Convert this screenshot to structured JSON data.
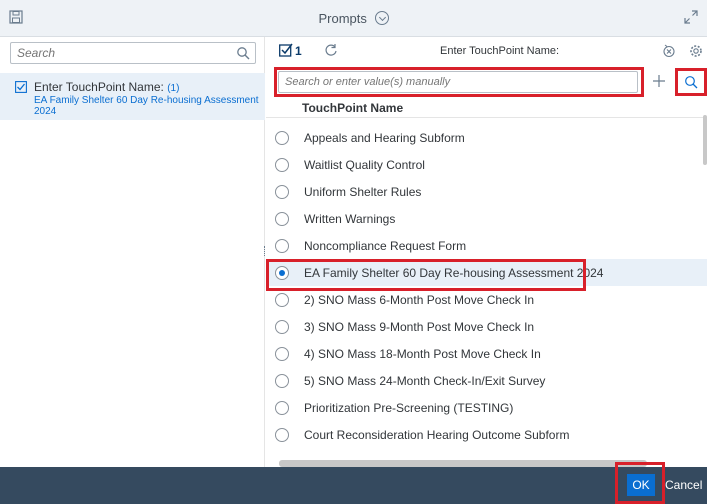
{
  "header": {
    "title": "Prompts"
  },
  "left_panel": {
    "search_placeholder": "Search",
    "prompt_item": {
      "label": "Enter TouchPoint Name:",
      "count": "(1)",
      "value": "EA Family Shelter 60 Day Re-housing Assessment 2024"
    }
  },
  "right_panel": {
    "selected_count": "1",
    "prompt_label": "Enter TouchPoint Name:",
    "value_search_placeholder": "Search or enter value(s) manually",
    "column_header": "TouchPoint Name",
    "rows": [
      {
        "label": "Appeals and Hearing Subform",
        "selected": false
      },
      {
        "label": "Waitlist Quality Control",
        "selected": false
      },
      {
        "label": "Uniform Shelter Rules",
        "selected": false
      },
      {
        "label": "Written Warnings",
        "selected": false
      },
      {
        "label": "Noncompliance Request Form",
        "selected": false
      },
      {
        "label": "EA Family Shelter 60 Day Re-housing Assessment 2024",
        "selected": true
      },
      {
        "label": "2) SNO Mass 6-Month Post Move Check In",
        "selected": false
      },
      {
        "label": "3) SNO Mass 9-Month Post Move Check In",
        "selected": false
      },
      {
        "label": "4) SNO Mass 18-Month Post Move Check In",
        "selected": false
      },
      {
        "label": "5) SNO Mass 24-Month Check-In/Exit Survey",
        "selected": false
      },
      {
        "label": "Prioritization Pre-Screening (TESTING)",
        "selected": false
      },
      {
        "label": "Court Reconsideration Hearing Outcome Subform",
        "selected": false
      }
    ]
  },
  "footer": {
    "ok_label": "OK",
    "cancel_label": "Cancel"
  },
  "colors": {
    "accent": "#0a6ed1",
    "footer_bg": "#354a5f",
    "highlight": "#d8202a"
  }
}
